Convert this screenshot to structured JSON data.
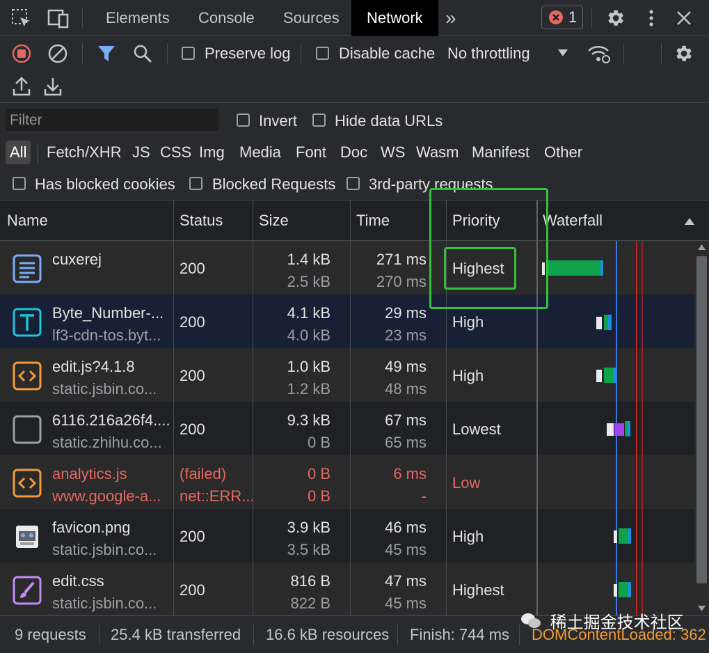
{
  "tabs": {
    "elements": "Elements",
    "console": "Console",
    "sources": "Sources",
    "network": "Network",
    "more": "»",
    "error_count": "1"
  },
  "toolbar": {
    "preserve_log": "Preserve log",
    "disable_cache": "Disable cache",
    "throttling": "No throttling"
  },
  "filter": {
    "placeholder": "Filter",
    "invert": "Invert",
    "hide_data_urls": "Hide data URLs",
    "types": [
      "All",
      "Fetch/XHR",
      "JS",
      "CSS",
      "Img",
      "Media",
      "Font",
      "Doc",
      "WS",
      "Wasm",
      "Manifest",
      "Other"
    ],
    "has_blocked_cookies": "Has blocked cookies",
    "blocked_requests": "Blocked Requests",
    "third_party": "3rd-party requests"
  },
  "columns": {
    "name": "Name",
    "status": "Status",
    "size": "Size",
    "time": "Time",
    "priority": "Priority",
    "waterfall": "Waterfall"
  },
  "rows": [
    {
      "name": "cuxerej",
      "sub": "",
      "status": "200",
      "status2": "",
      "size": "1.4 kB",
      "size2": "2.5 kB",
      "time": "271 ms",
      "time2": "270 ms",
      "priority": "Highest",
      "icon": "document-icon"
    },
    {
      "name": "Byte_Number-...",
      "sub": "lf3-cdn-tos.byt...",
      "status": "200",
      "status2": "",
      "size": "4.1 kB",
      "size2": "4.0 kB",
      "time": "29 ms",
      "time2": "23 ms",
      "priority": "High",
      "icon": "font-icon"
    },
    {
      "name": "edit.js?4.1.8",
      "sub": "static.jsbin.co...",
      "status": "200",
      "status2": "",
      "size": "1.0 kB",
      "size2": "1.2 kB",
      "time": "49 ms",
      "time2": "48 ms",
      "priority": "High",
      "icon": "script-icon"
    },
    {
      "name": "6116.216a26f4....",
      "sub": "static.zhihu.co...",
      "status": "200",
      "status2": "",
      "size": "9.3 kB",
      "size2": "0 B",
      "time": "67 ms",
      "time2": "65 ms",
      "priority": "Lowest",
      "icon": "blank-file-icon"
    },
    {
      "name": "analytics.js",
      "sub": "www.google-a...",
      "status": "(failed)",
      "status2": "net::ERR...",
      "size": "0 B",
      "size2": "0 B",
      "time": "6 ms",
      "time2": "-",
      "priority": "Low",
      "icon": "script-icon"
    },
    {
      "name": "favicon.png",
      "sub": "static.jsbin.co...",
      "status": "200",
      "status2": "",
      "size": "3.9 kB",
      "size2": "3.5 kB",
      "time": "46 ms",
      "time2": "45 ms",
      "priority": "High",
      "icon": "image-icon"
    },
    {
      "name": "edit.css",
      "sub": "static.jsbin.co...",
      "status": "200",
      "status2": "",
      "size": "816 B",
      "size2": "822 B",
      "time": "47 ms",
      "time2": "45 ms",
      "priority": "Highest",
      "icon": "stylesheet-icon"
    }
  ],
  "statusbar": {
    "requests": "9 requests",
    "transferred": "25.4 kB transferred",
    "resources": "16.6 kB resources",
    "finish": "Finish: 744 ms",
    "dom": "DOMContentLoaded: 362"
  },
  "watermark": "稀土掘金技术社区",
  "colors": {
    "highlight": "#33c23d",
    "failed": "#e46962",
    "accent": "#7cacf8"
  }
}
